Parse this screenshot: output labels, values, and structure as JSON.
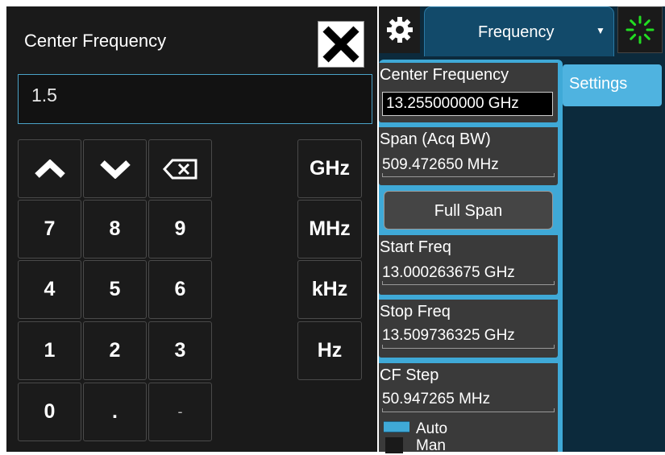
{
  "keypad": {
    "title": "Center Frequency",
    "entry_value": "1.5",
    "keys": {
      "up": "up-arrow",
      "down": "down-arrow",
      "backspace": "backspace",
      "k7": "7",
      "k8": "8",
      "k9": "9",
      "k4": "4",
      "k5": "5",
      "k6": "6",
      "k1": "1",
      "k2": "2",
      "k3": "3",
      "k0": "0",
      "dot": ".",
      "minus": "-"
    },
    "units": [
      "GHz",
      "MHz",
      "kHz",
      "Hz"
    ],
    "close_icon": "close-icon"
  },
  "toolbar": {
    "settings_icon": "gear-icon",
    "menu_tab": "Frequency",
    "menu_tab_arrow": "▼",
    "status_icon": "busy-spinner-icon"
  },
  "menu": {
    "side_tab": "Settings",
    "center_freq": {
      "label": "Center Frequency",
      "value": "13.255000000 GHz"
    },
    "span": {
      "label": "Span (Acq BW)",
      "value": "509.472650 MHz"
    },
    "full_span": "Full Span",
    "start_freq": {
      "label": "Start Freq",
      "value": "13.000263675 GHz"
    },
    "stop_freq": {
      "label": "Stop Freq",
      "value": "13.509736325 GHz"
    },
    "cf_step": {
      "label": "CF Step",
      "value": "50.947265 MHz",
      "options": [
        "Auto",
        "Man"
      ],
      "selected": "Auto"
    }
  },
  "colors": {
    "accent": "#3fa9d7",
    "keypad_bg": "#1a1a1a",
    "panel_bg": "#3a3a3a",
    "spinner": "#22dd22"
  }
}
